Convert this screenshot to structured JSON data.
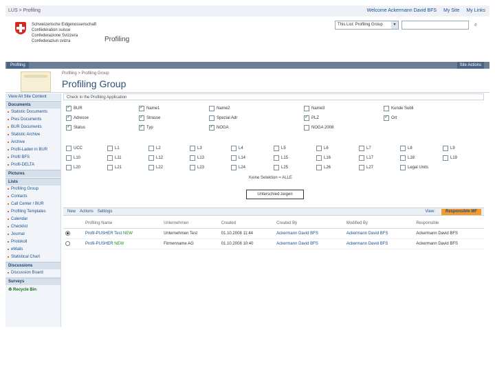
{
  "topbar": {
    "crumb": "LUS > Profiling",
    "welcome": "Welcome Ackermann David BFS",
    "mysite": "My Site",
    "mylinks": "My Links"
  },
  "header": {
    "confed": [
      "Schweizerische Eidgenossenschaft",
      "Confédération suisse",
      "Confederazione Svizzera",
      "Confederaziun svizra"
    ],
    "site_name": "Profiling",
    "search_scope": "This List: Profiling Group"
  },
  "nav": {
    "tab": "Profiling",
    "site_actions": "Site Actions"
  },
  "title": {
    "breadcrumb": "Profiling > Profiling Group",
    "page_title": "Profiling Group"
  },
  "leftnav": {
    "view_all": "View All Site Content",
    "sections": [
      {
        "head": "Documents",
        "items": [
          "Statistic Documents",
          "Pres Documents",
          "BUR Documents",
          "Statistic Archive",
          "Archive",
          "Profil-Laden in BUR",
          "Profil BFS",
          "Profil-DELTA"
        ]
      },
      {
        "head": "Pictures",
        "items": []
      },
      {
        "head": "Lists",
        "items": [
          "Profiling Group",
          "Contacts",
          "Call Center / BUR",
          "Profiling Templates",
          "Calendar",
          "Checklist",
          "Journal",
          "Protokoll",
          "eMails",
          "Statistical Chart"
        ]
      },
      {
        "head": "Discussions",
        "items": [
          "Discussion Board"
        ]
      },
      {
        "head": "Surveys",
        "items": []
      }
    ],
    "recycle": "Recycle Bin"
  },
  "filter": {
    "header": "Check in the Profiling Application",
    "row1": [
      {
        "label": "BUR",
        "checked": true
      },
      {
        "label": "Name1",
        "checked": true
      },
      {
        "label": "Name2",
        "checked": false
      },
      {
        "label": "Name3",
        "checked": false
      },
      {
        "label": "Kunde Subli",
        "checked": false
      }
    ],
    "row2": [
      {
        "label": "Adresse",
        "checked": true
      },
      {
        "label": "Strasse",
        "checked": true
      },
      {
        "label": "Spezial Adr",
        "checked": false
      },
      {
        "label": "PLZ",
        "checked": true
      },
      {
        "label": "Ort",
        "checked": true
      }
    ],
    "row3": [
      {
        "label": "Status",
        "checked": true
      },
      {
        "label": "Typ",
        "checked": true
      },
      {
        "label": "NOGA",
        "checked": true
      },
      {
        "label": "NOGA 2008",
        "checked": false
      }
    ],
    "grid": [
      [
        "UCC",
        "L1",
        "L2",
        "L3",
        "L4",
        "L5",
        "L6",
        "L7",
        "L8",
        "L9"
      ],
      [
        "L10",
        "L11",
        "L12",
        "L13",
        "L14",
        "L15",
        "L16",
        "L17",
        "L18",
        "L19"
      ],
      [
        "L20",
        "L21",
        "L22",
        "L23",
        "L24",
        "L25",
        "L26",
        "L27",
        "Legal Units"
      ]
    ],
    "all_selection": "Keine Selektion = ALLE",
    "show_button": "Unterschied zeigen"
  },
  "toolbar": {
    "new": "New",
    "actions": "Actions",
    "settings": "Settings",
    "view_label": "View:",
    "view_value": "Responsible MF"
  },
  "table": {
    "headers": [
      "",
      "",
      "Profiling Name",
      "Unternehmen",
      "Created",
      "Created By",
      "Modified By",
      "Responsible"
    ],
    "rows": [
      {
        "selected": true,
        "name": "Profil-PUSHER Test",
        "new": "NEW",
        "company": "Unternehmen Test",
        "created": "01.10.2008 11:44",
        "created_by": "Ackermann David BFS",
        "modified_by": "Ackermann David BFS",
        "responsible": "Ackermann David BFS"
      },
      {
        "selected": false,
        "name": "Profil-PUSHER",
        "new": "NEW",
        "company": "Firmenname AG",
        "created": "01.10.2008 10:40",
        "created_by": "Ackermann David BFS",
        "modified_by": "Ackermann David BFS",
        "responsible": "Ackermann David BFS"
      }
    ]
  }
}
